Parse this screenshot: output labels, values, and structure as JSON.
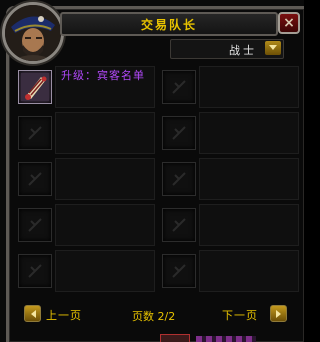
{
  "window": {
    "title": "交易队长",
    "close_label": "×"
  },
  "filter": {
    "class_value": "战士"
  },
  "items": [
    {
      "name": "升级：宾客名单",
      "icon": "scroll-icon",
      "quality_color": "#b048f8"
    }
  ],
  "pagination": {
    "prev_label": "上一页",
    "next_label": "下一页",
    "page_label": "页数 2/2"
  }
}
